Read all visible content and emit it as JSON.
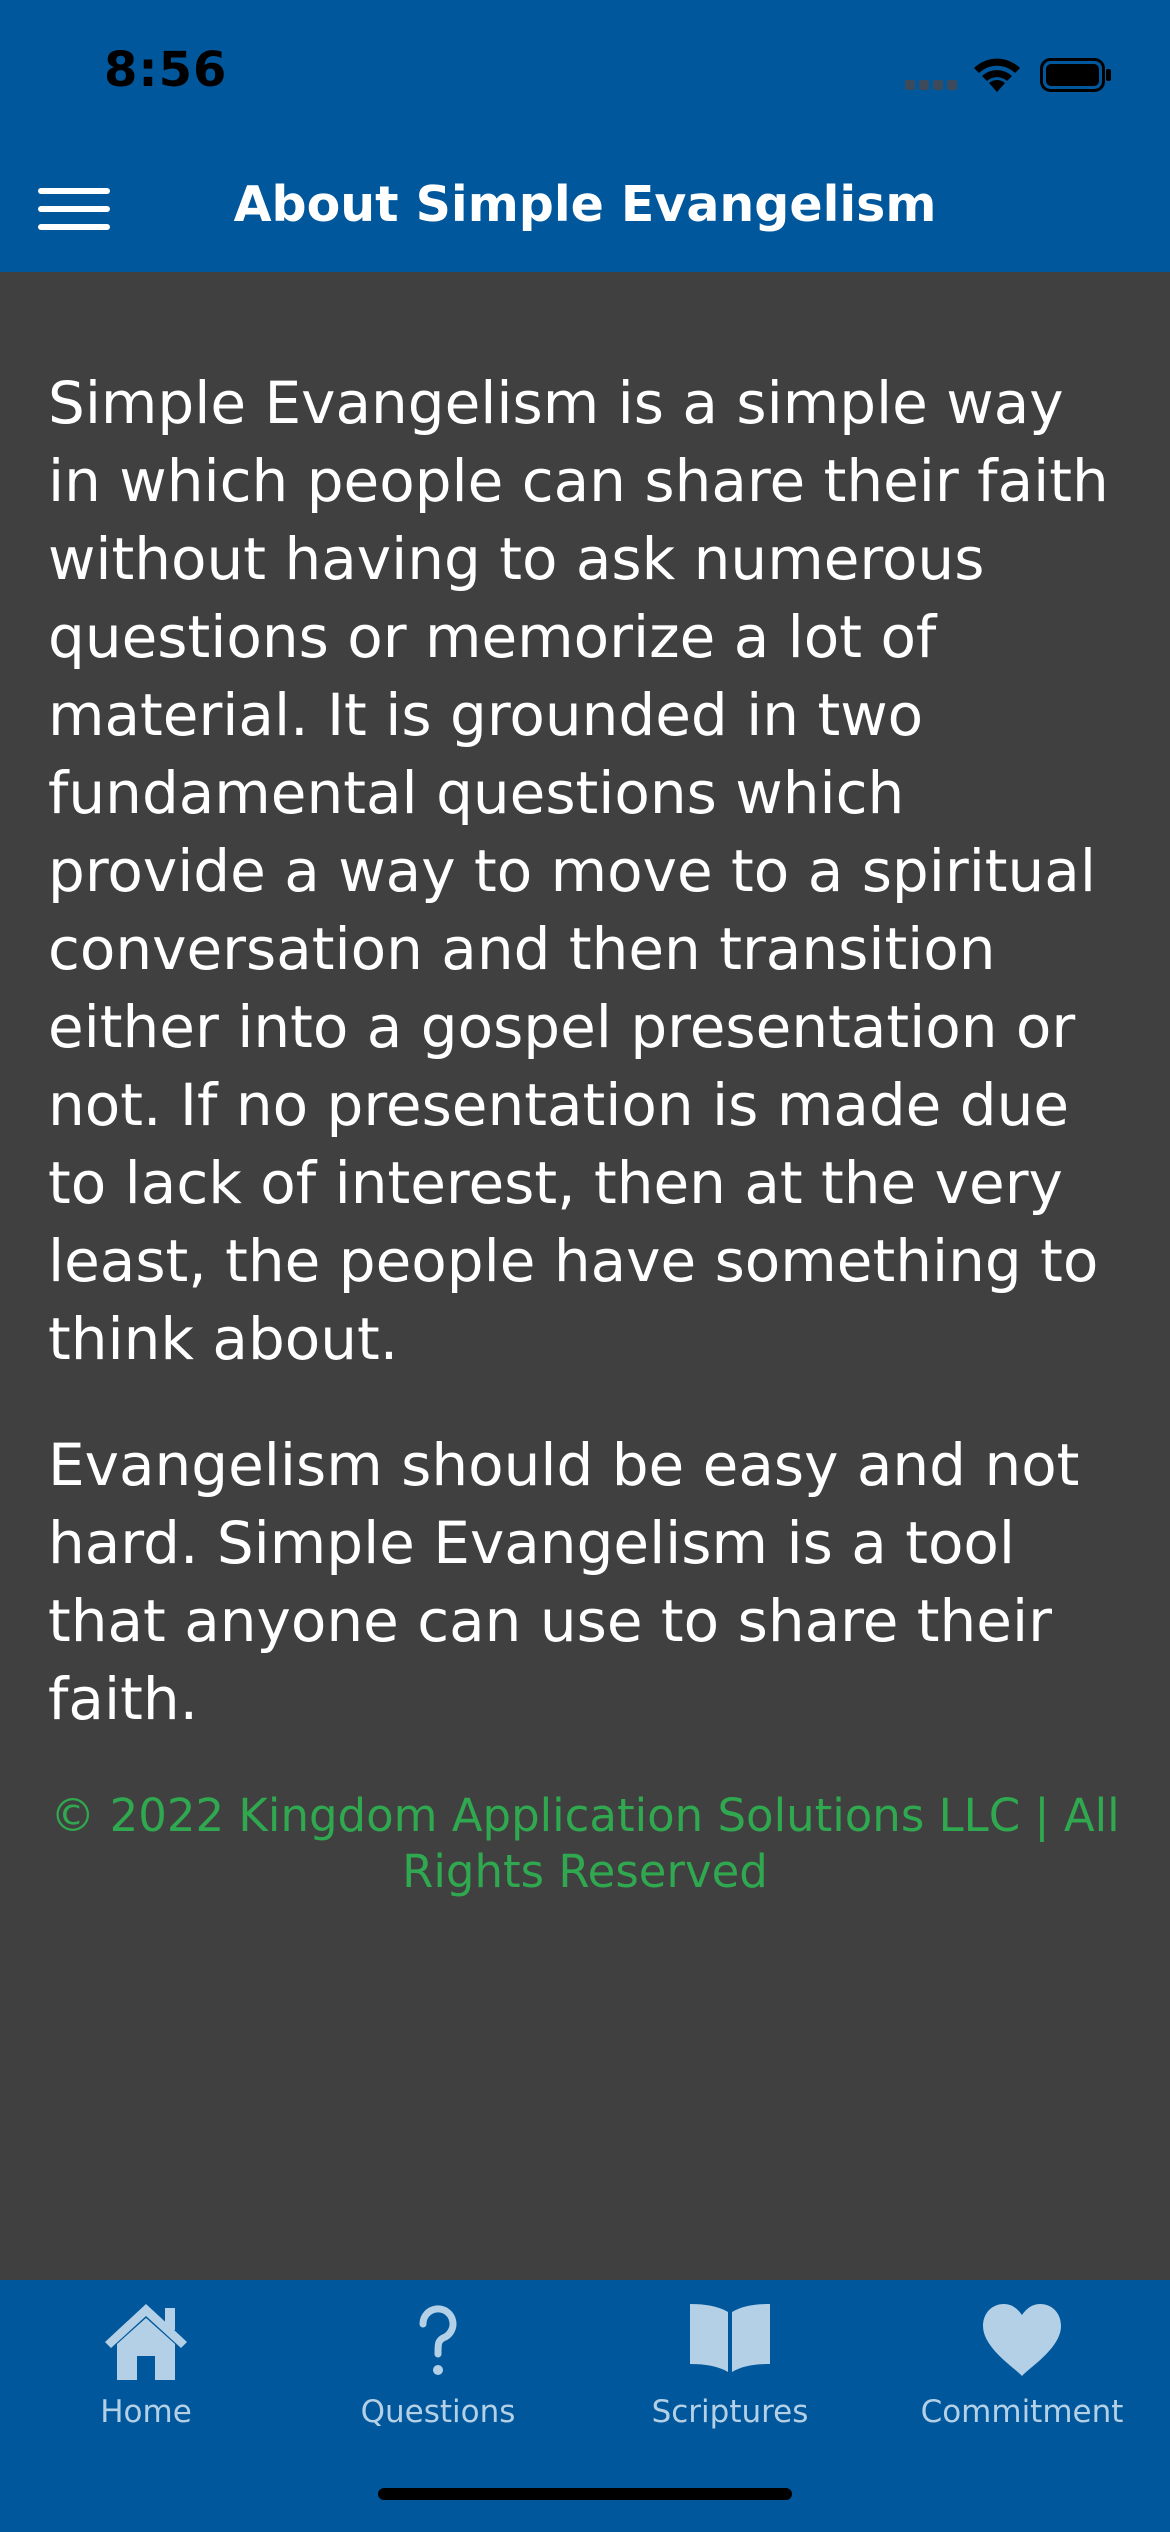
{
  "status_bar": {
    "time": "8:56"
  },
  "header": {
    "title": "About Simple Evangelism",
    "menu_icon": "hamburger-menu-icon"
  },
  "content": {
    "paragraphs": [
      "Simple Evangelism is a simple way in which people can share their faith without having to ask numerous questions or memorize a lot of material. It is grounded in two fundamental questions which provide a way to move to a spiritual conversation and then transition either into a gospel presentation or not. If no presentation is made due to lack of interest, then at the very least, the people have something to think about.",
      "Evangelism should be easy and not hard. Simple Evangelism is a tool that anyone can use to share their faith."
    ],
    "copyright": "© 2022 Kingdom Application Solutions LLC | All Rights Reserved"
  },
  "tab_bar": {
    "tabs": [
      {
        "label": "Home",
        "icon": "home-icon"
      },
      {
        "label": "Questions",
        "icon": "question-mark-icon"
      },
      {
        "label": "Scriptures",
        "icon": "open-book-icon"
      },
      {
        "label": "Commitment",
        "icon": "heart-icon"
      }
    ]
  },
  "colors": {
    "header_background": "#01579b",
    "page_background": "#404040",
    "body_text": "#ffffff",
    "copyright_text": "#2fa84f",
    "tab_inactive": "#b3d0e6"
  }
}
